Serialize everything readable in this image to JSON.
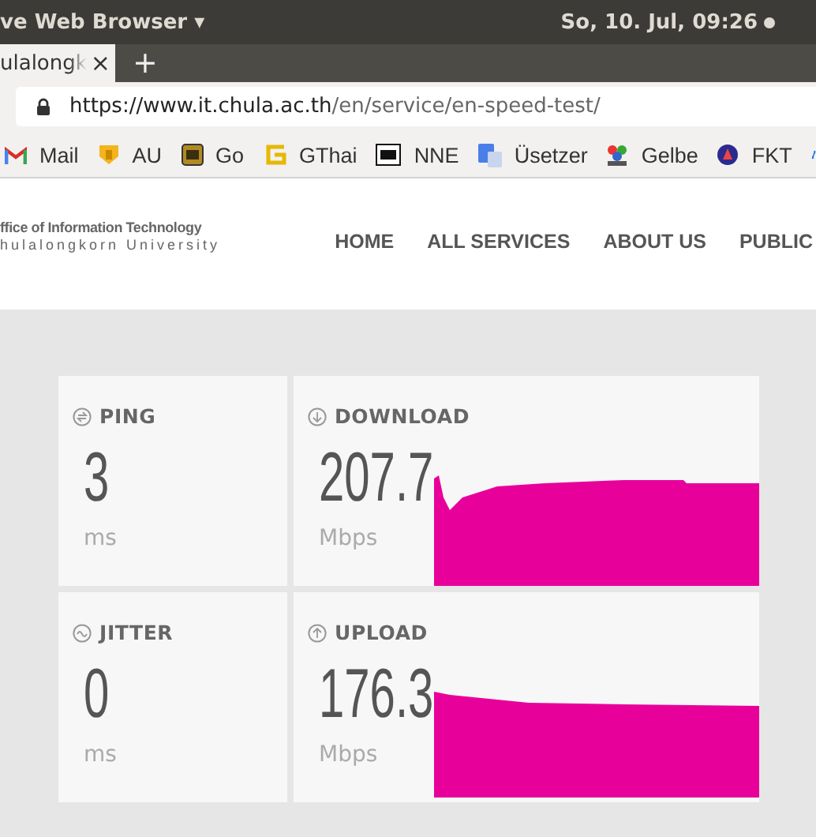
{
  "system_bar": {
    "app_menu": "ve Web Browser ▾",
    "clock": "So, 10. Jul, 09:26"
  },
  "tabs": [
    {
      "label": "ulalongk",
      "close": "×",
      "selected": true
    }
  ],
  "new_tab": "+",
  "address_bar": {
    "url_host": "https://www.it.chula.ac.th",
    "url_path": "/en/service/en-speed-test/"
  },
  "bookmarks": [
    {
      "label": "Mail"
    },
    {
      "label": "AU"
    },
    {
      "label": "Go"
    },
    {
      "label": "GThai"
    },
    {
      "label": "NNE"
    },
    {
      "label": "Üsetzer"
    },
    {
      "label": "Gelbe"
    },
    {
      "label": "FKT"
    }
  ],
  "site_header": {
    "logo_line_1": "ffice of Information Technology",
    "logo_line_2": "hulalongkorn University",
    "nav": [
      "HOME",
      "ALL SERVICES",
      "ABOUT US",
      "PUBLIC"
    ]
  },
  "metrics": [
    {
      "kind": "ping",
      "label": "PING",
      "value": "3",
      "unit": "ms"
    },
    {
      "kind": "download",
      "label": "DOWNLOAD",
      "value": "207.7",
      "unit": "Mbps"
    },
    {
      "kind": "jitter",
      "label": "JITTER",
      "value": "0",
      "unit": "ms"
    },
    {
      "kind": "upload",
      "label": "UPLOAD",
      "value": "176.3",
      "unit": "Mbps"
    }
  ]
}
